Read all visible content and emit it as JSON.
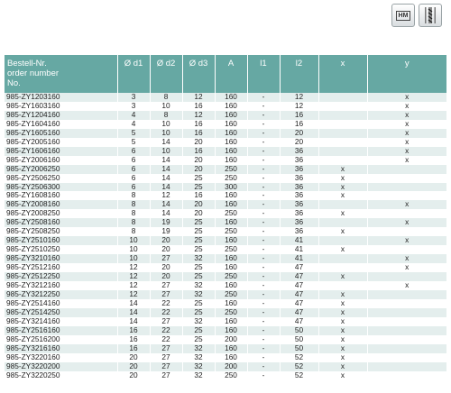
{
  "icons": [
    {
      "name": "hm-carbide-icon",
      "label": "HM"
    },
    {
      "name": "coolant-drill-icon",
      "label": ""
    }
  ],
  "table": {
    "headers": [
      "Bestell-Nr.\norder number\nNo.",
      "Ø d1",
      "Ø d2",
      "Ø d3",
      "A",
      "l1",
      "l2",
      "x",
      "y"
    ],
    "rows": [
      [
        "985-ZY1203160",
        "3",
        "8",
        "12",
        "160",
        "-",
        "12",
        "",
        "x"
      ],
      [
        "985-ZY1603160",
        "3",
        "10",
        "16",
        "160",
        "-",
        "12",
        "",
        "x"
      ],
      [
        "985-ZY1204160",
        "4",
        "8",
        "12",
        "160",
        "-",
        "16",
        "",
        "x"
      ],
      [
        "985-ZY1604160",
        "4",
        "10",
        "16",
        "160",
        "-",
        "16",
        "",
        "x"
      ],
      [
        "985-ZY1605160",
        "5",
        "10",
        "16",
        "160",
        "-",
        "20",
        "",
        "x"
      ],
      [
        "985-ZY2005160",
        "5",
        "14",
        "20",
        "160",
        "-",
        "20",
        "",
        "x"
      ],
      [
        "985-ZY1606160",
        "6",
        "10",
        "16",
        "160",
        "-",
        "36",
        "",
        "x"
      ],
      [
        "985-ZY2006160",
        "6",
        "14",
        "20",
        "160",
        "-",
        "36",
        "",
        "x"
      ],
      [
        "985-ZY2006250",
        "6",
        "14",
        "20",
        "250",
        "-",
        "36",
        "x",
        ""
      ],
      [
        "985-ZY2506250",
        "6",
        "14",
        "25",
        "250",
        "-",
        "36",
        "x",
        ""
      ],
      [
        "985-ZY2506300",
        "6",
        "14",
        "25",
        "300",
        "-",
        "36",
        "x",
        ""
      ],
      [
        "985-ZY1608160",
        "8",
        "12",
        "16",
        "160",
        "-",
        "36",
        "x",
        ""
      ],
      [
        "985-ZY2008160",
        "8",
        "14",
        "20",
        "160",
        "-",
        "36",
        "",
        "x"
      ],
      [
        "985-ZY2008250",
        "8",
        "14",
        "20",
        "250",
        "-",
        "36",
        "x",
        ""
      ],
      [
        "985-ZY2508160",
        "8",
        "19",
        "25",
        "160",
        "-",
        "36",
        "",
        "x"
      ],
      [
        "985-ZY2508250",
        "8",
        "19",
        "25",
        "250",
        "-",
        "36",
        "x",
        ""
      ],
      [
        "985-ZY2510160",
        "10",
        "20",
        "25",
        "160",
        "-",
        "41",
        "",
        "x"
      ],
      [
        "985-ZY2510250",
        "10",
        "20",
        "25",
        "250",
        "-",
        "41",
        "x",
        ""
      ],
      [
        "985-ZY3210160",
        "10",
        "27",
        "32",
        "160",
        "-",
        "41",
        "",
        "x"
      ],
      [
        "985-ZY2512160",
        "12",
        "20",
        "25",
        "160",
        "-",
        "47",
        "",
        "x"
      ],
      [
        "985-ZY2512250",
        "12",
        "20",
        "25",
        "250",
        "-",
        "47",
        "x",
        ""
      ],
      [
        "985-ZY3212160",
        "12",
        "27",
        "32",
        "160",
        "-",
        "47",
        "",
        "x"
      ],
      [
        "985-ZY3212250",
        "12",
        "27",
        "32",
        "250",
        "-",
        "47",
        "x",
        ""
      ],
      [
        "985-ZY2514160",
        "14",
        "22",
        "25",
        "160",
        "-",
        "47",
        "x",
        ""
      ],
      [
        "985-ZY2514250",
        "14",
        "22",
        "25",
        "250",
        "-",
        "47",
        "x",
        ""
      ],
      [
        "985-ZY3214160",
        "14",
        "27",
        "32",
        "160",
        "-",
        "47",
        "x",
        ""
      ],
      [
        "985-ZY2516160",
        "16",
        "22",
        "25",
        "160",
        "-",
        "50",
        "x",
        ""
      ],
      [
        "985-ZY2516200",
        "16",
        "22",
        "25",
        "200",
        "-",
        "50",
        "x",
        ""
      ],
      [
        "985-ZY3216160",
        "16",
        "27",
        "32",
        "160",
        "-",
        "50",
        "x",
        ""
      ],
      [
        "985-ZY3220160",
        "20",
        "27",
        "32",
        "160",
        "-",
        "52",
        "x",
        ""
      ],
      [
        "985-ZY3220200",
        "20",
        "27",
        "32",
        "200",
        "-",
        "52",
        "x",
        ""
      ],
      [
        "985-ZY3220250",
        "20",
        "27",
        "32",
        "250",
        "-",
        "52",
        "x",
        ""
      ]
    ]
  }
}
